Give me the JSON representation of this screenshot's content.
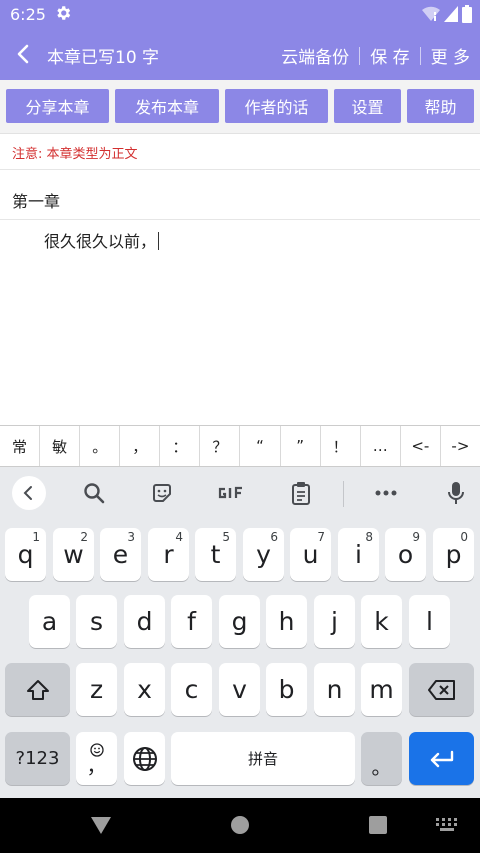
{
  "status": {
    "time": "6:25"
  },
  "header": {
    "title": "本章已写10 字",
    "actions": [
      "云端备份",
      "保 存",
      "更 多"
    ]
  },
  "toolbar": {
    "buttons": [
      "分享本章",
      "发布本章",
      "作者的话",
      "设置",
      "帮助"
    ]
  },
  "notice": "注意: 本章类型为正文",
  "editor": {
    "chapter_title": "第一章",
    "body": "很久很久以前，"
  },
  "symbol_bar": [
    "常",
    "敏",
    "。",
    "，",
    "：",
    "？",
    "“",
    "”",
    "！",
    "…",
    "<-",
    "->"
  ],
  "keyboard": {
    "row1": [
      {
        "k": "q",
        "n": "1"
      },
      {
        "k": "w",
        "n": "2"
      },
      {
        "k": "e",
        "n": "3"
      },
      {
        "k": "r",
        "n": "4"
      },
      {
        "k": "t",
        "n": "5"
      },
      {
        "k": "y",
        "n": "6"
      },
      {
        "k": "u",
        "n": "7"
      },
      {
        "k": "i",
        "n": "8"
      },
      {
        "k": "o",
        "n": "9"
      },
      {
        "k": "p",
        "n": "0"
      }
    ],
    "row2": [
      "a",
      "s",
      "d",
      "f",
      "g",
      "h",
      "j",
      "k",
      "l"
    ],
    "row3": [
      "z",
      "x",
      "c",
      "v",
      "b",
      "n",
      "m"
    ],
    "symbols_label": "?123",
    "comma_label": "，",
    "space_label": "拼音",
    "period_label": "。"
  },
  "colors": {
    "accent": "#8c87e6",
    "notice": "#d32f2f",
    "enter": "#1a73e8"
  }
}
